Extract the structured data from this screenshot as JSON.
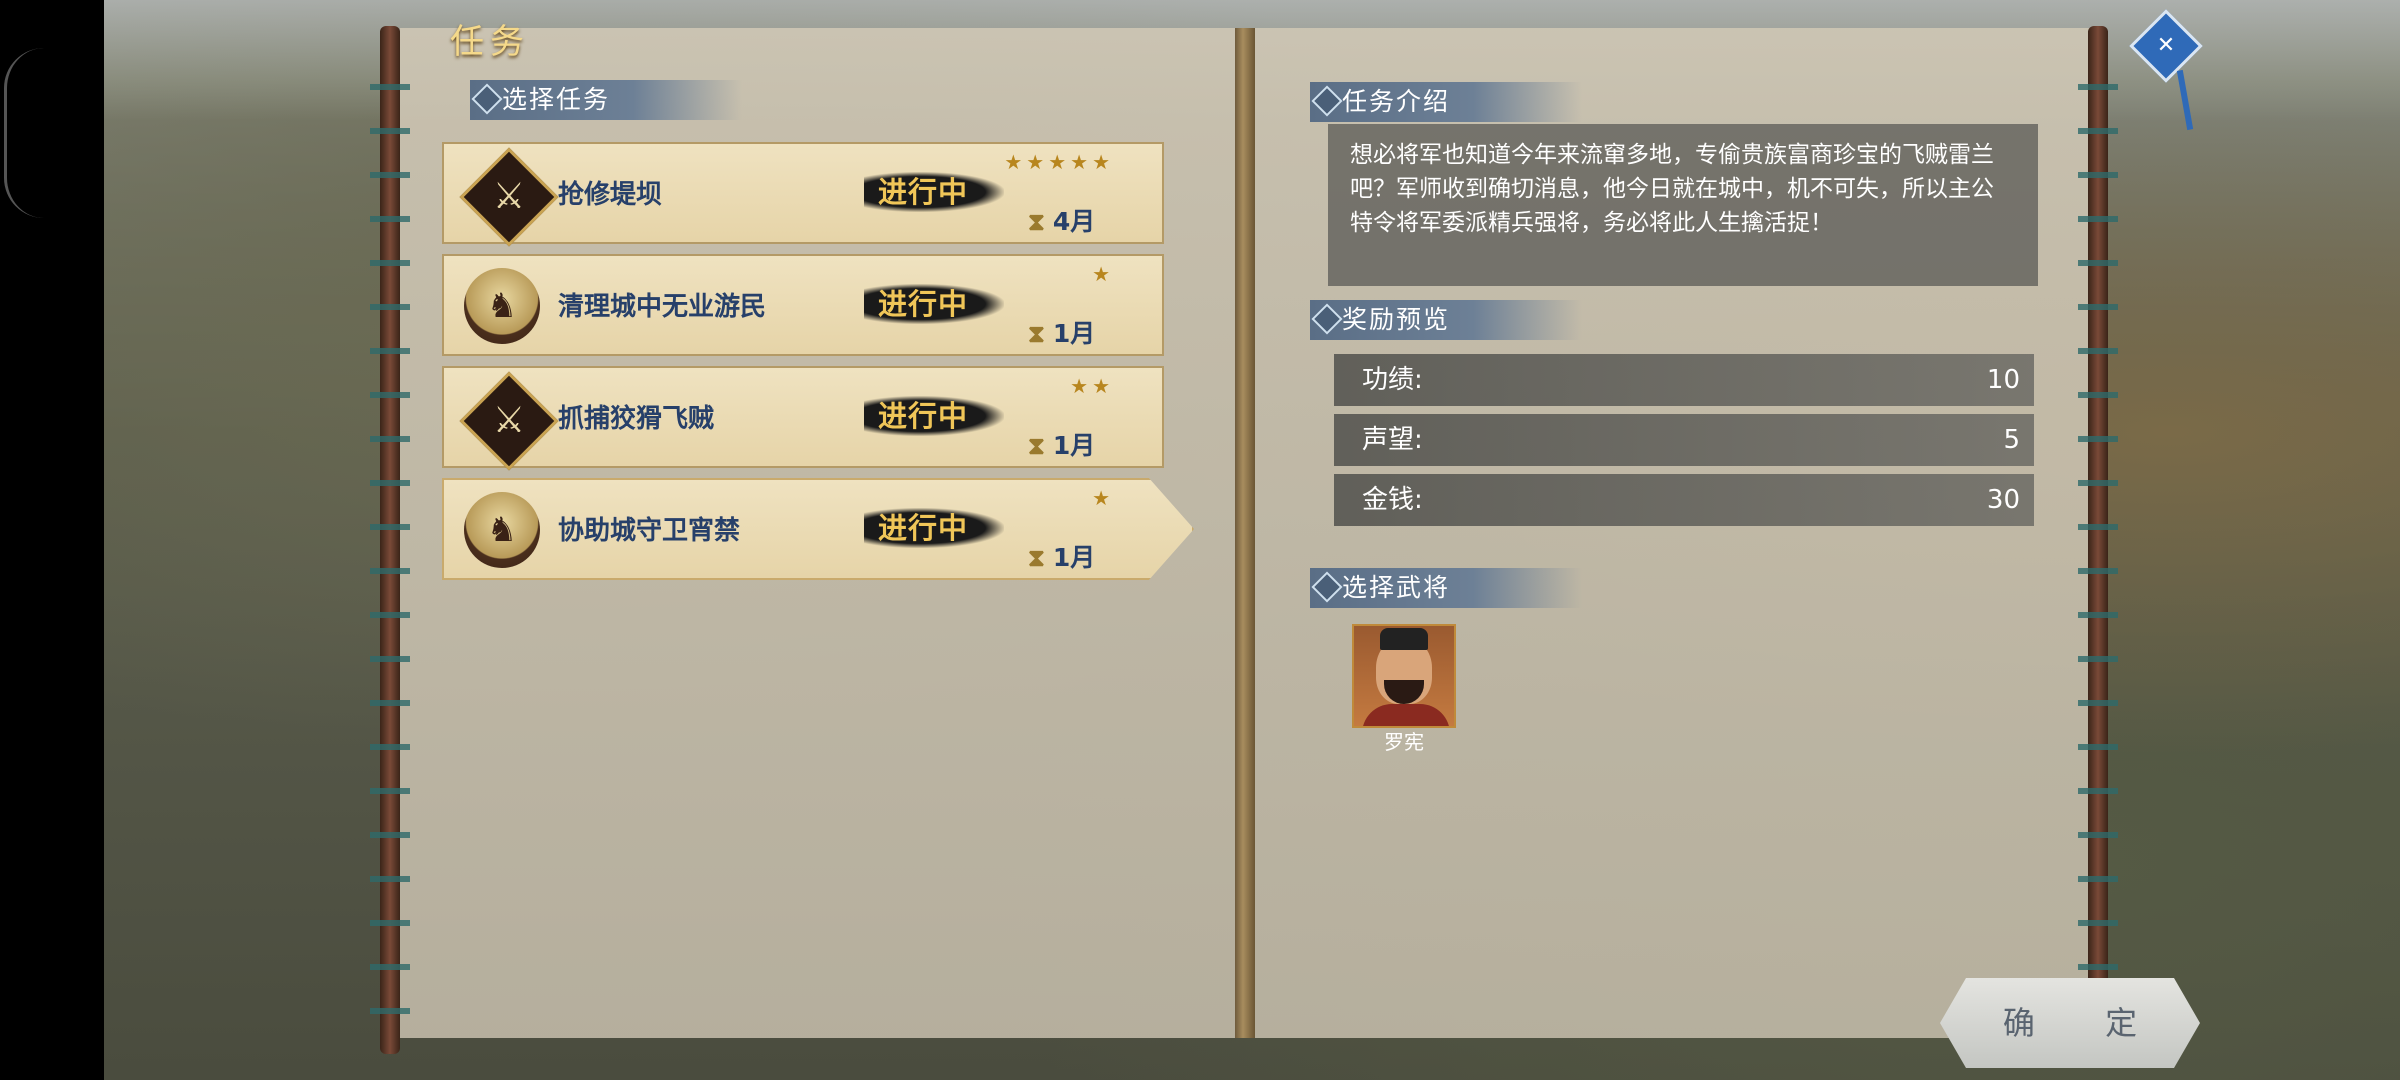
{
  "window": {
    "title": "任务"
  },
  "left_page": {
    "section_title": "选择任务",
    "tasks": [
      {
        "name": "抢修堤坝",
        "status": "进行中",
        "duration": "4月",
        "stars": "★★★★★",
        "emblem": "sword-emblem-icon"
      },
      {
        "name": "清理城中无业游民",
        "status": "进行中",
        "duration": "1月",
        "stars": "★",
        "emblem": "cavalry-emblem-icon"
      },
      {
        "name": "抓捕狡猾飞贼",
        "status": "进行中",
        "duration": "1月",
        "stars": "★★",
        "emblem": "sword-emblem-icon"
      },
      {
        "name": "协助城守卫宵禁",
        "status": "进行中",
        "duration": "1月",
        "stars": "★",
        "emblem": "cavalry-emblem-icon"
      }
    ]
  },
  "right_page": {
    "intro_title": "任务介绍",
    "intro_text": "想必将军也知道今年来流窜多地，专偷贵族富商珍宝的飞贼雷兰吧？军师收到确切消息，他今日就在城中，机不可失，所以主公特令将军委派精兵强将，务必将此人生擒活捉！",
    "reward_title": "奖励预览",
    "rewards": [
      {
        "label": "功绩:",
        "value": "10"
      },
      {
        "label": "声望:",
        "value": "5"
      },
      {
        "label": "金钱:",
        "value": "30"
      }
    ],
    "general_title": "选择武将",
    "general": {
      "name": "罗宪"
    }
  },
  "confirm_button": "确 定",
  "icons": {
    "close": "close-badge-icon",
    "hourglass": "hourglass-icon"
  },
  "colors": {
    "accent_gold": "#f5d98a",
    "task_name": "#27406a",
    "status_gold": "#f0c658"
  }
}
